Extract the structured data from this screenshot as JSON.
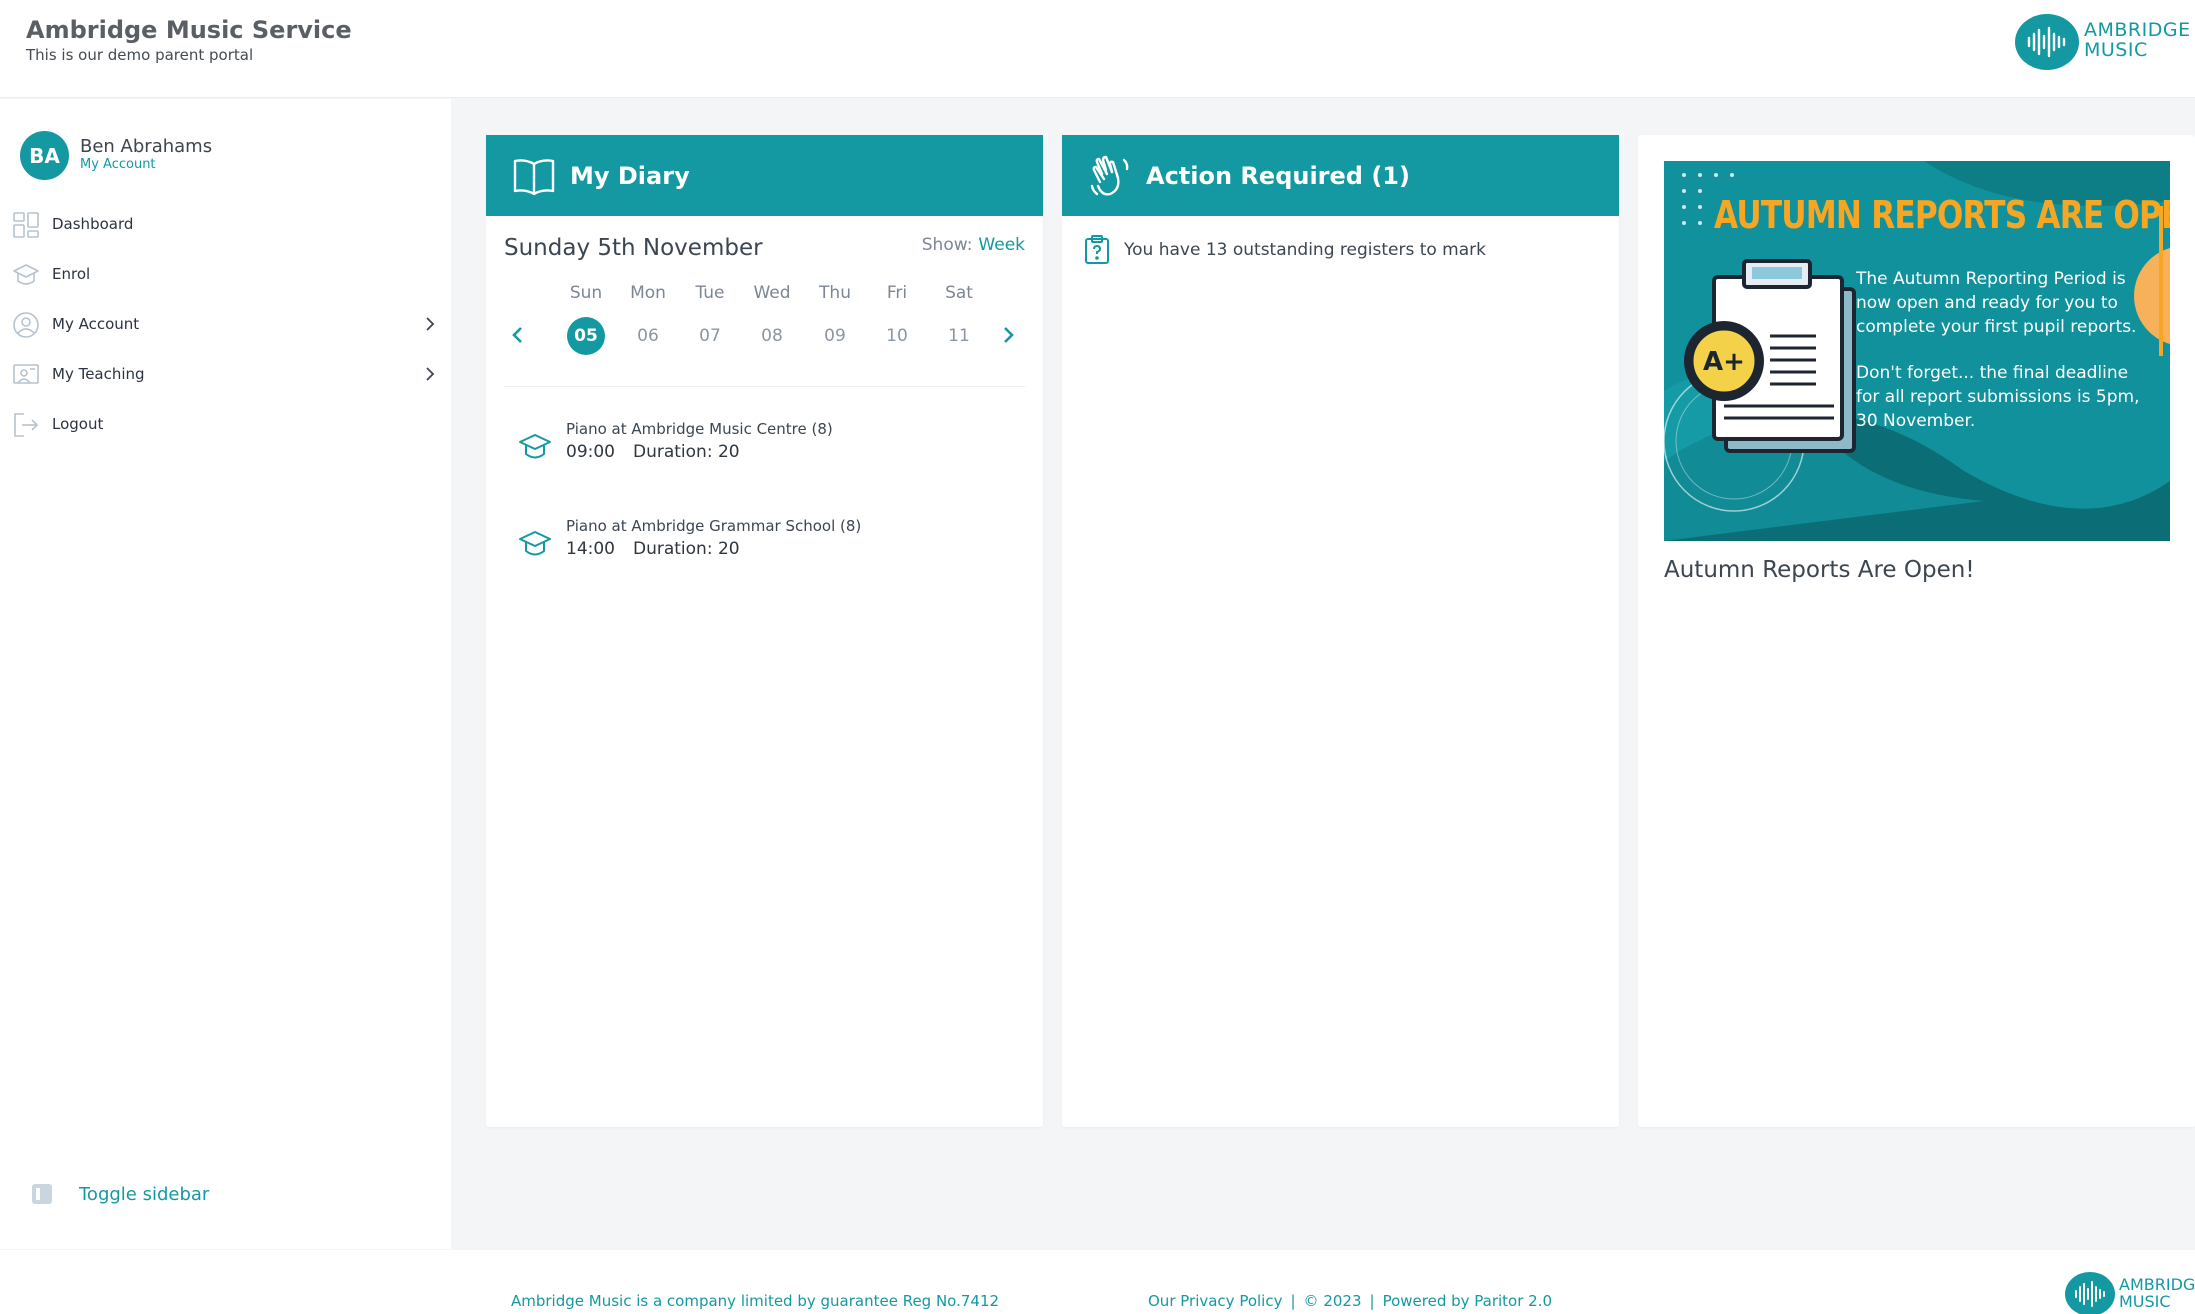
{
  "header": {
    "title": "Ambridge Music Service",
    "subtitle": "This is our demo parent portal",
    "logo_line1": "AMBRIDGE",
    "logo_line2": "MUSIC"
  },
  "sidebar": {
    "user": {
      "initials": "BA",
      "name": "Ben Abrahams",
      "sub": "My Account"
    },
    "items": [
      {
        "label": "Dashboard",
        "icon": "dashboard-icon"
      },
      {
        "label": "Enrol",
        "icon": "graduation-cap-icon"
      },
      {
        "label": "My Account",
        "icon": "user-circle-icon",
        "has_submenu": true
      },
      {
        "label": "My Teaching",
        "icon": "teaching-board-icon",
        "has_submenu": true
      },
      {
        "label": "Logout",
        "icon": "logout-icon"
      }
    ],
    "toggle_label": "Toggle sidebar"
  },
  "diary": {
    "title": "My Diary",
    "date": "Sunday 5th November",
    "show_label": "Show:",
    "show_value": "Week",
    "days": [
      "Sun",
      "Mon",
      "Tue",
      "Wed",
      "Thu",
      "Fri",
      "Sat"
    ],
    "dates": [
      "05",
      "06",
      "07",
      "08",
      "09",
      "10",
      "11"
    ],
    "selected_index": 0,
    "lessons": [
      {
        "title": "Piano at Ambridge Music Centre (8)",
        "time": "09:00",
        "duration": "Duration: 20"
      },
      {
        "title": "Piano at Ambridge Grammar School (8)",
        "time": "14:00",
        "duration": "Duration: 20"
      }
    ]
  },
  "actions": {
    "title": "Action Required (1)",
    "items": [
      {
        "text": "You have 13 outstanding registers to mark",
        "icon": "clipboard-question-icon"
      }
    ]
  },
  "news": {
    "headline": "AUTUMN REPORTS ARE OPEN!",
    "body_p1": "The Autumn Reporting Period is now open and ready for you to complete your first pupil reports.",
    "body_p2": "Don't forget... the final deadline for all report submissions is 5pm, 30 November.",
    "badge": "A+",
    "caption": "Autumn Reports Are Open!"
  },
  "footer": {
    "company": "Ambridge Music is a company limited by guarantee Reg No.7412",
    "privacy": "Our Privacy Policy",
    "copyright": "© 2023",
    "powered": "Powered by Paritor 2.0",
    "separator": "|",
    "logo_line1": "AMBRIDGE",
    "logo_line2": "MUSIC"
  },
  "colors": {
    "brand": "#1499a3",
    "accent": "#f6a623",
    "background": "#f4f5f7"
  }
}
